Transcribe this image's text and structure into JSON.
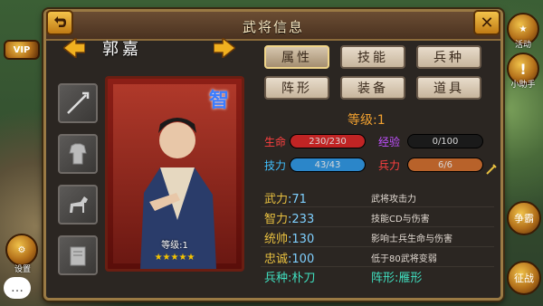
{
  "window": {
    "title": "武将信息"
  },
  "hero": {
    "name": "郭嘉",
    "type_badge": "智",
    "level_label": "等级:1",
    "stars": 5
  },
  "tabs": [
    {
      "label": "属性",
      "active": true
    },
    {
      "label": "技能",
      "active": false
    },
    {
      "label": "兵种",
      "active": false
    },
    {
      "label": "阵形",
      "active": false
    },
    {
      "label": "装备",
      "active": false
    },
    {
      "label": "道具",
      "active": false
    }
  ],
  "stats": {
    "level": "等级:1",
    "hp": {
      "label": "生命",
      "value": "230/230",
      "fill": 1.0,
      "color": "#c02424"
    },
    "exp": {
      "label": "经验",
      "value": "0/100",
      "fill": 0.0,
      "color": "#2a2a2a"
    },
    "skill": {
      "label": "技力",
      "value": "43/43",
      "fill": 1.0,
      "color": "#2b86c9"
    },
    "troops": {
      "label": "兵力",
      "value": "6/6",
      "fill": 1.0,
      "color": "#b8622a"
    }
  },
  "attributes": [
    {
      "name": "武力",
      "value": ":71",
      "desc": "武将攻击力"
    },
    {
      "name": "智力",
      "value": ":233",
      "desc": "技能CD与伤害"
    },
    {
      "name": "统帅",
      "value": ":130",
      "desc": "影响士兵生命与伤害"
    },
    {
      "name": "忠诚",
      "value": ":100",
      "desc": "低于80武将变弱"
    }
  ],
  "unit_row": {
    "troop": "兵种:朴刀",
    "formation": "阵形:雁形"
  },
  "side_left": {
    "vip": "VIP",
    "settings": "设置"
  },
  "side_right": {
    "event": "活动",
    "helper": "小助手",
    "battle": "争霸",
    "war": "征战"
  },
  "colors": {
    "accent": "#9a7a44",
    "panel_bg": "#2b2622",
    "title_bg": "#4a3220"
  }
}
